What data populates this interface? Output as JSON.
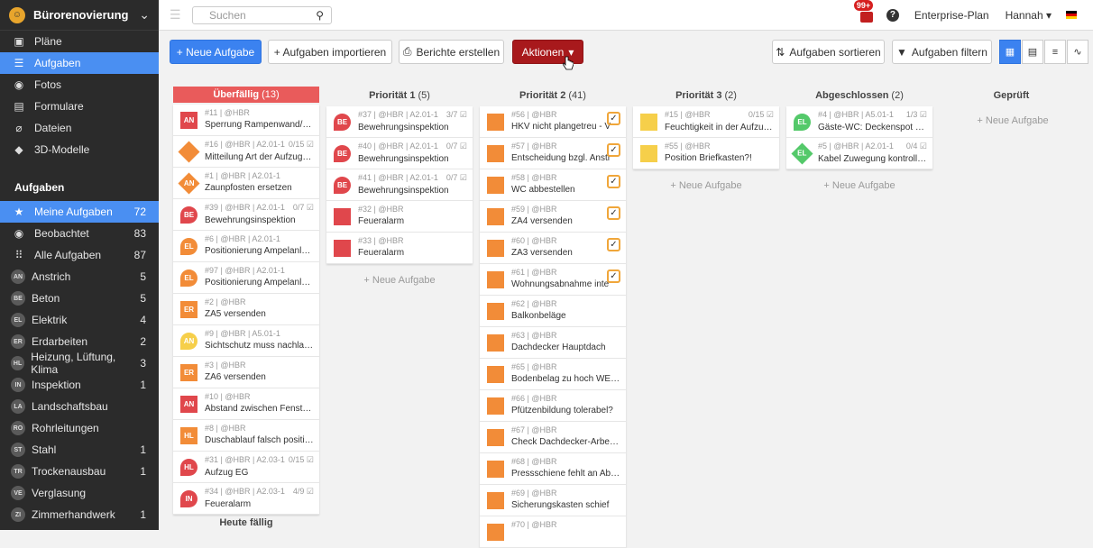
{
  "sidebar": {
    "project": "Bürorenovierung",
    "nav": [
      {
        "icon": "map-icon",
        "glyph": "▣",
        "label": "Pläne"
      },
      {
        "icon": "list-icon",
        "glyph": "☰",
        "label": "Aufgaben",
        "active": true
      },
      {
        "icon": "camera-icon",
        "glyph": "◉",
        "label": "Fotos"
      },
      {
        "icon": "form-icon",
        "glyph": "▤",
        "label": "Formulare"
      },
      {
        "icon": "paperclip-icon",
        "glyph": "⌀",
        "label": "Dateien"
      },
      {
        "icon": "cube-icon",
        "glyph": "◆",
        "label": "3D-Modelle"
      }
    ],
    "section_title": "Aufgaben",
    "filters": [
      {
        "icon": "star-icon",
        "glyph": "★",
        "label": "Meine Aufgaben",
        "count": "72",
        "active": true
      },
      {
        "icon": "eye-icon",
        "glyph": "◉",
        "label": "Beobachtet",
        "count": "83"
      },
      {
        "icon": "grid-icon",
        "glyph": "⠿",
        "label": "Alle Aufgaben",
        "count": "87"
      }
    ],
    "trades": [
      {
        "abbr": "AN",
        "label": "Anstrich",
        "count": "5"
      },
      {
        "abbr": "BE",
        "label": "Beton",
        "count": "5"
      },
      {
        "abbr": "EL",
        "label": "Elektrik",
        "count": "4"
      },
      {
        "abbr": "ER",
        "label": "Erdarbeiten",
        "count": "2"
      },
      {
        "abbr": "HL",
        "label": "Heizung, Lüftung, Klima",
        "count": "3"
      },
      {
        "abbr": "IN",
        "label": "Inspektion",
        "count": "1"
      },
      {
        "abbr": "LA",
        "label": "Landschaftsbau",
        "count": ""
      },
      {
        "abbr": "RO",
        "label": "Rohrleitungen",
        "count": ""
      },
      {
        "abbr": "ST",
        "label": "Stahl",
        "count": "1"
      },
      {
        "abbr": "TR",
        "label": "Trockenausbau",
        "count": "1"
      },
      {
        "abbr": "VE",
        "label": "Verglasung",
        "count": ""
      },
      {
        "abbr": "ZI",
        "label": "Zimmerhandwerk",
        "count": "1"
      }
    ]
  },
  "topbar": {
    "search_placeholder": "Suchen",
    "badge": "99+",
    "plan": "Enterprise-Plan",
    "user": "Hannah ▾"
  },
  "toolbar": {
    "new_task": "+ Neue Aufgabe",
    "import": "+ Aufgaben importieren",
    "reports": "Berichte erstellen",
    "actions": "Aktionen",
    "sort": "Aufgaben sortieren",
    "filter": "Aufgaben filtern"
  },
  "colors": {
    "red": "#e0474c",
    "orange": "#f28c38",
    "yellow": "#f6cf4a",
    "green": "#54c96a",
    "blue": "#3b82f0"
  },
  "columns": [
    {
      "title": "Überfällig",
      "count": "(13)",
      "red": true,
      "cards": [
        {
          "meta": "#11 | @HBR",
          "right": "",
          "title": "Sperrung Rampenwand/T-...",
          "shape": "sq",
          "color": "red",
          "abbr": "AN"
        },
        {
          "meta": "#16 | @HBR | A2.01-1",
          "right": "0/15 ☑",
          "title": "Mitteilung Art der Aufzugs...",
          "shape": "dia",
          "color": "orange",
          "abbr": ""
        },
        {
          "meta": "#1 | @HBR | A2.01-1",
          "right": "",
          "title": "Zaunpfosten ersetzen",
          "shape": "dia",
          "color": "orange",
          "abbr": "AN"
        },
        {
          "meta": "#39 | @HBR | A2.01-1",
          "right": "0/7 ☑",
          "title": "Bewehrungsinspektion",
          "shape": "pin",
          "color": "red",
          "abbr": "BE"
        },
        {
          "meta": "#6 | @HBR | A2.01-1",
          "right": "",
          "title": "Positionierung Ampelanlag...",
          "shape": "pin",
          "color": "orange",
          "abbr": "EL"
        },
        {
          "meta": "#97 | @HBR | A2.01-1",
          "right": "",
          "title": "Positionierung Ampelanlag...",
          "shape": "pin",
          "color": "orange",
          "abbr": "EL"
        },
        {
          "meta": "#2 | @HBR",
          "right": "",
          "title": "ZA5 versenden",
          "shape": "sq",
          "color": "orange",
          "abbr": "ER"
        },
        {
          "meta": "#9 | @HBR | A5.01-1",
          "right": "",
          "title": "Sichtschutz muss nachlacki...",
          "shape": "pin",
          "color": "yellow",
          "abbr": "AN"
        },
        {
          "meta": "#3 | @HBR",
          "right": "",
          "title": "ZA6 versenden",
          "shape": "sq",
          "color": "orange",
          "abbr": "ER"
        },
        {
          "meta": "#10 | @HBR",
          "right": "",
          "title": "Abstand zwischen Fenster ...",
          "shape": "sq",
          "color": "red",
          "abbr": "AN"
        },
        {
          "meta": "#8 | @HBR",
          "right": "",
          "title": "Duschablauf falsch positio...",
          "shape": "sq",
          "color": "orange",
          "abbr": "HL"
        },
        {
          "meta": "#31 | @HBR | A2.03-1",
          "right": "0/15 ☑",
          "title": "Aufzug EG",
          "shape": "pin",
          "color": "red",
          "abbr": "HL"
        },
        {
          "meta": "#34 | @HBR | A2.03-1",
          "right": "4/9 ☑",
          "title": "Feueralarm",
          "shape": "pin",
          "color": "red",
          "abbr": "IN"
        }
      ]
    },
    {
      "title": "Priorität 1",
      "count": "(5)",
      "cards": [
        {
          "meta": "#37 | @HBR | A2.01-1",
          "right": "3/7 ☑",
          "title": "Bewehrungsinspektion",
          "shape": "pin",
          "color": "red",
          "abbr": "BE"
        },
        {
          "meta": "#40 | @HBR | A2.01-1",
          "right": "0/7 ☑",
          "title": "Bewehrungsinspektion",
          "shape": "pin",
          "color": "red",
          "abbr": "BE"
        },
        {
          "meta": "#41 | @HBR | A2.01-1",
          "right": "0/7 ☑",
          "title": "Bewehrungsinspektion",
          "shape": "pin",
          "color": "red",
          "abbr": "BE"
        },
        {
          "meta": "#32 | @HBR",
          "right": "",
          "title": "Feueralarm",
          "shape": "sq",
          "color": "red",
          "abbr": ""
        },
        {
          "meta": "#33 | @HBR",
          "right": "",
          "title": "Feueralarm",
          "shape": "sq",
          "color": "red",
          "abbr": ""
        }
      ]
    },
    {
      "title": "Priorität 2",
      "count": "(41)",
      "cards": [
        {
          "meta": "#56 | @HBR",
          "right": "",
          "title": "HKV nicht plangetreu - V",
          "shape": "sq",
          "color": "orange",
          "abbr": "",
          "chk": true
        },
        {
          "meta": "#57 | @HBR",
          "right": "",
          "title": "Entscheidung bzgl. Anstr",
          "shape": "sq",
          "color": "orange",
          "abbr": "",
          "chk": true
        },
        {
          "meta": "#58 | @HBR",
          "right": "",
          "title": "WC abbestellen",
          "shape": "sq",
          "color": "orange",
          "abbr": "",
          "chk": true
        },
        {
          "meta": "#59 | @HBR",
          "right": "",
          "title": "ZA4 versenden",
          "shape": "sq",
          "color": "orange",
          "abbr": "",
          "chk": true
        },
        {
          "meta": "#60 | @HBR",
          "right": "",
          "title": "ZA3 versenden",
          "shape": "sq",
          "color": "orange",
          "abbr": "",
          "chk": true
        },
        {
          "meta": "#61 | @HBR",
          "right": "",
          "title": "Wohnungsabnahme inte",
          "shape": "sq",
          "color": "orange",
          "abbr": "",
          "chk": true
        },
        {
          "meta": "#62 | @HBR",
          "right": "",
          "title": "Balkonbeläge",
          "shape": "sq",
          "color": "orange",
          "abbr": ""
        },
        {
          "meta": "#63 | @HBR",
          "right": "",
          "title": "Dachdecker Hauptdach",
          "shape": "sq",
          "color": "orange",
          "abbr": ""
        },
        {
          "meta": "#65 | @HBR",
          "right": "",
          "title": "Bodenbelag zu hoch WE5+6",
          "shape": "sq",
          "color": "orange",
          "abbr": ""
        },
        {
          "meta": "#66 | @HBR",
          "right": "",
          "title": "Pfützenbildung tolerabel?",
          "shape": "sq",
          "color": "orange",
          "abbr": ""
        },
        {
          "meta": "#67 | @HBR",
          "right": "",
          "title": "Check Dachdecker-Arbeiten",
          "shape": "sq",
          "color": "orange",
          "abbr": ""
        },
        {
          "meta": "#68 | @HBR",
          "right": "",
          "title": "Pressschiene fehlt an Abdi...",
          "shape": "sq",
          "color": "orange",
          "abbr": ""
        },
        {
          "meta": "#69 | @HBR",
          "right": "",
          "title": "Sicherungskasten schief",
          "shape": "sq",
          "color": "orange",
          "abbr": ""
        },
        {
          "meta": "#70 | @HBR",
          "right": "",
          "title": "",
          "shape": "sq",
          "color": "orange",
          "abbr": ""
        }
      ]
    },
    {
      "title": "Priorität 3",
      "count": "(2)",
      "cards": [
        {
          "meta": "#15 | @HBR",
          "right": "0/15 ☑",
          "title": "Feuchtigkeit in der Aufzug...",
          "shape": "sq",
          "color": "yellow",
          "abbr": ""
        },
        {
          "meta": "#55 | @HBR",
          "right": "",
          "title": "Position Briefkasten?!",
          "shape": "sq",
          "color": "yellow",
          "abbr": ""
        }
      ]
    },
    {
      "title": "Abgeschlossen",
      "count": "(2)",
      "cards": [
        {
          "meta": "#4 | @HBR | A5.01-1",
          "right": "1/3 ☑",
          "title": "Gäste-WC: Deckenspot üb...",
          "shape": "pin",
          "color": "green",
          "abbr": "EL"
        },
        {
          "meta": "#5 | @HBR | A2.01-1",
          "right": "0/4 ☑",
          "title": "Kabel Zuwegung kontrollie...",
          "shape": "dia",
          "color": "green",
          "abbr": "EL"
        }
      ]
    },
    {
      "title": "Geprüft",
      "count": "",
      "cards": []
    }
  ],
  "new_task_link": "+ Neue Aufgabe",
  "heute_faellig": "Heute fällig"
}
